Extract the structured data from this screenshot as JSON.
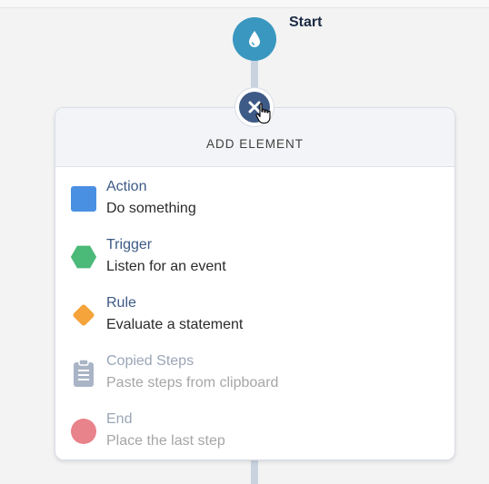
{
  "start": {
    "label": "Start",
    "icon": "water-drop-icon"
  },
  "panel": {
    "title": "ADD ELEMENT",
    "close_icon": "close-icon",
    "items": [
      {
        "title": "Action",
        "desc": "Do something",
        "icon": "square-icon",
        "color": "#4a90e2",
        "disabled": false
      },
      {
        "title": "Trigger",
        "desc": "Listen for an event",
        "icon": "hexagon-icon",
        "color": "#4bb978",
        "disabled": false
      },
      {
        "title": "Rule",
        "desc": "Evaluate a statement",
        "icon": "diamond-icon",
        "color": "#f5a33b",
        "disabled": false
      },
      {
        "title": "Copied Steps",
        "desc": "Paste steps from clipboard",
        "icon": "clipboard-icon",
        "color": "#a9b4c6",
        "disabled": true
      },
      {
        "title": "End",
        "desc": "Place the last step",
        "icon": "circle-icon",
        "color": "#e8828b",
        "disabled": true
      }
    ]
  }
}
